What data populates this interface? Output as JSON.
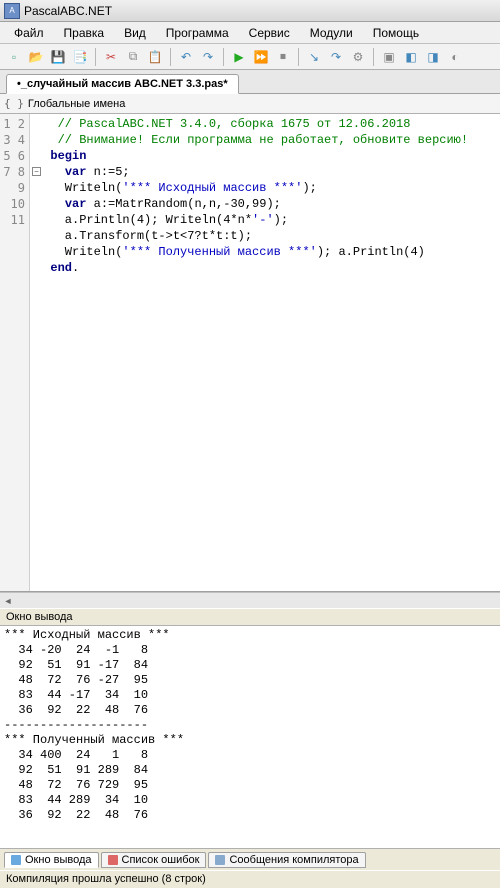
{
  "window": {
    "title": "PascalABC.NET"
  },
  "menu": {
    "items": [
      "Файл",
      "Правка",
      "Вид",
      "Программа",
      "Сервис",
      "Модули",
      "Помощь"
    ]
  },
  "toolbar": {
    "icons": [
      {
        "name": "new-file-icon",
        "glyph": "▫",
        "color": "#5a8"
      },
      {
        "name": "open-icon",
        "glyph": "📂",
        "color": "#da0"
      },
      {
        "name": "save-icon",
        "glyph": "💾",
        "color": "#48b"
      },
      {
        "name": "save-all-icon",
        "glyph": "📑",
        "color": "#48b"
      },
      {
        "name": "sep"
      },
      {
        "name": "cut-icon",
        "glyph": "✂",
        "color": "#c44"
      },
      {
        "name": "copy-icon",
        "glyph": "⧉",
        "color": "#888"
      },
      {
        "name": "paste-icon",
        "glyph": "📋",
        "color": "#888"
      },
      {
        "name": "sep"
      },
      {
        "name": "undo-icon",
        "glyph": "↶",
        "color": "#48b"
      },
      {
        "name": "redo-icon",
        "glyph": "↷",
        "color": "#48b"
      },
      {
        "name": "sep"
      },
      {
        "name": "run-icon",
        "glyph": "▶",
        "color": "#2a2"
      },
      {
        "name": "run-no-debug-icon",
        "glyph": "⏩",
        "color": "#2a2"
      },
      {
        "name": "stop-icon",
        "glyph": "⏹",
        "color": "#888"
      },
      {
        "name": "sep"
      },
      {
        "name": "step-into-icon",
        "glyph": "↘",
        "color": "#48b"
      },
      {
        "name": "step-over-icon",
        "glyph": "↷",
        "color": "#48b"
      },
      {
        "name": "compile-icon",
        "glyph": "⚙",
        "color": "#888"
      },
      {
        "name": "sep"
      },
      {
        "name": "form-icon",
        "glyph": "▣",
        "color": "#888"
      },
      {
        "name": "window-icon",
        "glyph": "◧",
        "color": "#48b"
      },
      {
        "name": "window2-icon",
        "glyph": "◨",
        "color": "#48b"
      },
      {
        "name": "options-icon",
        "glyph": "◐",
        "color": "#888"
      }
    ]
  },
  "tab": {
    "label": "•_случайный массив ABC.NET 3.3.pas*"
  },
  "namesbar": {
    "label": "Глобальные имена"
  },
  "editor": {
    "lines": [
      {
        "n": 1,
        "segs": [
          {
            "cls": "c-com",
            "t": "   // PascalABC.NET 3.4.0, сборка 1675 от 12.06.2018"
          }
        ]
      },
      {
        "n": 2,
        "segs": [
          {
            "cls": "c-com",
            "t": "   // Внимание! Если программа не работает, обновите версию!"
          }
        ]
      },
      {
        "n": 3,
        "segs": [
          {
            "cls": "",
            "t": ""
          }
        ]
      },
      {
        "n": 4,
        "fold": true,
        "segs": [
          {
            "cls": "c-kw",
            "t": "  begin"
          }
        ]
      },
      {
        "n": 5,
        "segs": [
          {
            "cls": "",
            "t": "    "
          },
          {
            "cls": "c-kw",
            "t": "var"
          },
          {
            "cls": "",
            "t": " n:=5;"
          }
        ]
      },
      {
        "n": 6,
        "segs": [
          {
            "cls": "",
            "t": "    Writeln("
          },
          {
            "cls": "c-str",
            "t": "'*** Исходный массив ***'"
          },
          {
            "cls": "",
            "t": ");"
          }
        ]
      },
      {
        "n": 7,
        "segs": [
          {
            "cls": "",
            "t": "    "
          },
          {
            "cls": "c-kw",
            "t": "var"
          },
          {
            "cls": "",
            "t": " a:=MatrRandom(n,n,-30,99);"
          }
        ]
      },
      {
        "n": 8,
        "segs": [
          {
            "cls": "",
            "t": "    a.Println(4); Writeln(4*n*"
          },
          {
            "cls": "c-str",
            "t": "'-'"
          },
          {
            "cls": "",
            "t": ");"
          }
        ]
      },
      {
        "n": 9,
        "segs": [
          {
            "cls": "",
            "t": "    a.Transform(t->t<7?t*t:t);"
          }
        ]
      },
      {
        "n": 10,
        "segs": [
          {
            "cls": "",
            "t": "    Writeln("
          },
          {
            "cls": "c-str",
            "t": "'*** Полученный массив ***'"
          },
          {
            "cls": "",
            "t": "); a.Println(4)"
          }
        ]
      },
      {
        "n": 11,
        "segs": [
          {
            "cls": "c-kw",
            "t": "  end"
          },
          {
            "cls": "",
            "t": "."
          }
        ]
      }
    ]
  },
  "output": {
    "label": "Окно вывода",
    "text": "*** Исходный массив ***\n  34 -20  24  -1   8\n  92  51  91 -17  84\n  48  72  76 -27  95\n  83  44 -17  34  10\n  36  92  22  48  76\n--------------------\n*** Полученный массив ***\n  34 400  24   1   8\n  92  51  91 289  84\n  48  72  76 729  95\n  83  44 289  34  10\n  36  92  22  48  76"
  },
  "bottomTabs": {
    "items": [
      {
        "label": "Окно вывода",
        "iconColor": "#6aa8e0",
        "active": true
      },
      {
        "label": "Список ошибок",
        "iconColor": "#d66",
        "active": false
      },
      {
        "label": "Сообщения компилятора",
        "iconColor": "#8ac",
        "active": false
      }
    ]
  },
  "status": {
    "text": "Компиляция прошла успешно (8 строк)"
  }
}
